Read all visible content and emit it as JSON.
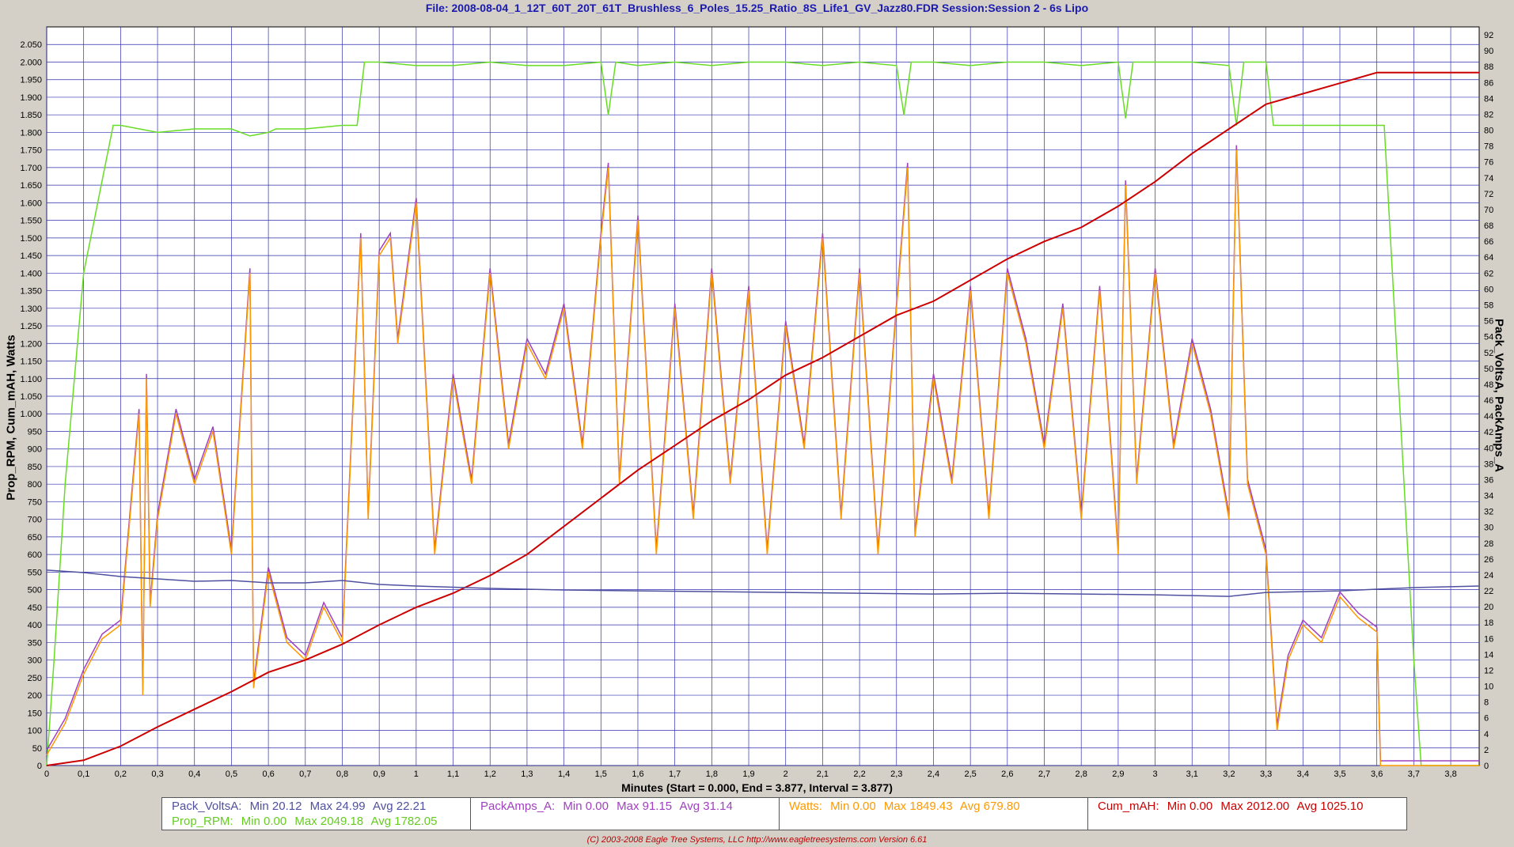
{
  "title": "File: 2008-08-04_1_12T_60T_20T_61T_Brushless_6_Poles_15.25_Ratio_8S_Life1_GV_Jazz80.FDR   Session:Session 2 - 6s Lipo",
  "ylabel_left": "Prop_RPM, Cum_mAH, Watts",
  "ylabel_right": "Pack_VoltsA, PackAmps_A",
  "xlabel": "Minutes (Start = 0.000,  End = 3.877,  Interval =  3.877)",
  "footer": "(C) 2003-2008 Eagle Tree Systems, LLC     http://www.eagletreesystems.com    Version 6.61",
  "colors": {
    "background": "#d4d0c8",
    "plot_bg": "#ffffff",
    "grid": "#2f2fb0",
    "pack_volts": "#5050a0",
    "pack_amps": "#a040c0",
    "watts": "#ff9900",
    "prop_rpm": "#66dd22",
    "cum_mah": "#cc0000"
  },
  "stats": {
    "pack_volts": {
      "name": "Pack_VoltsA:",
      "min": "Min 20.12",
      "max": "Max 24.99",
      "avg": "Avg 22.21"
    },
    "prop_rpm": {
      "name": "Prop_RPM:",
      "min": "Min 0.00",
      "max": "Max 2049.18",
      "avg": "Avg 1782.05"
    },
    "pack_amps": {
      "name": "PackAmps_A:",
      "min": "Min 0.00",
      "max": "Max 91.15",
      "avg": "Avg 31.14"
    },
    "watts": {
      "name": "Watts:",
      "min": "Min 0.00",
      "max": "Max 1849.43",
      "avg": "Avg 679.80"
    },
    "cum_mah": {
      "name": "Cum_mAH:",
      "min": "Min 0.00",
      "max": "Max 2012.00",
      "avg": "Avg 1025.10"
    }
  },
  "chart_data": {
    "type": "line",
    "xlim": [
      0,
      3.877
    ],
    "ylim_left": [
      0,
      2100
    ],
    "ylim_right": [
      0,
      93
    ],
    "grid": true,
    "x_ticks": [
      "0",
      "0,1",
      "0,2",
      "0,3",
      "0,4",
      "0,5",
      "0,6",
      "0,7",
      "0,8",
      "0,9",
      "1",
      "1,1",
      "1,2",
      "1,3",
      "1,4",
      "1,5",
      "1,6",
      "1,7",
      "1,8",
      "1,9",
      "2",
      "2,1",
      "2,2",
      "2,3",
      "2,4",
      "2,5",
      "2,6",
      "2,7",
      "2,8",
      "2,9",
      "3",
      "3,1",
      "3,2",
      "3,3",
      "3,4",
      "3,5",
      "3,6",
      "3,7",
      "3,8"
    ],
    "y_ticks_left": [
      "0",
      "50",
      "100",
      "150",
      "200",
      "250",
      "300",
      "350",
      "400",
      "450",
      "500",
      "550",
      "600",
      "650",
      "700",
      "750",
      "800",
      "850",
      "900",
      "950",
      "1.000",
      "1.050",
      "1.100",
      "1.150",
      "1.200",
      "1.250",
      "1.300",
      "1.350",
      "1.400",
      "1.450",
      "1.500",
      "1.550",
      "1.600",
      "1.650",
      "1.700",
      "1.750",
      "1.800",
      "1.850",
      "1.900",
      "1.950",
      "2.000",
      "2.050"
    ],
    "y_ticks_right": [
      "0",
      "2",
      "4",
      "6",
      "8",
      "10",
      "12",
      "14",
      "16",
      "18",
      "20",
      "22",
      "24",
      "26",
      "28",
      "30",
      "32",
      "34",
      "36",
      "38",
      "40",
      "42",
      "44",
      "46",
      "48",
      "50",
      "52",
      "54",
      "56",
      "58",
      "60",
      "62",
      "64",
      "66",
      "68",
      "70",
      "72",
      "74",
      "76",
      "78",
      "80",
      "82",
      "84",
      "86",
      "88",
      "90",
      "92"
    ],
    "series": [
      {
        "name": "Prop_RPM",
        "axis": "left",
        "x": [
          0,
          0.02,
          0.05,
          0.1,
          0.18,
          0.2,
          0.3,
          0.4,
          0.5,
          0.55,
          0.6,
          0.62,
          0.7,
          0.8,
          0.84,
          0.86,
          0.9,
          1.0,
          1.1,
          1.2,
          1.3,
          1.4,
          1.5,
          1.52,
          1.54,
          1.6,
          1.7,
          1.8,
          1.9,
          2.0,
          2.1,
          2.2,
          2.3,
          2.32,
          2.34,
          2.4,
          2.5,
          2.6,
          2.7,
          2.8,
          2.9,
          2.92,
          2.94,
          3.0,
          3.1,
          3.2,
          3.22,
          3.24,
          3.3,
          3.32,
          3.34,
          3.4,
          3.5,
          3.6,
          3.62,
          3.7,
          3.72,
          3.877
        ],
        "y": [
          0,
          300,
          800,
          1400,
          1820,
          1820,
          1800,
          1810,
          1810,
          1790,
          1800,
          1810,
          1810,
          1820,
          1820,
          2000,
          2000,
          1990,
          1990,
          2000,
          1990,
          1990,
          2000,
          1850,
          2000,
          1990,
          2000,
          1990,
          2000,
          2000,
          1990,
          2000,
          1990,
          1850,
          2000,
          2000,
          1990,
          2000,
          2000,
          1990,
          2000,
          1840,
          2000,
          2000,
          2000,
          1990,
          1820,
          2000,
          2000,
          1820,
          1820,
          1820,
          1820,
          1820,
          1820,
          300,
          0,
          0
        ]
      },
      {
        "name": "Watts",
        "axis": "left",
        "x": [
          0,
          0.05,
          0.1,
          0.15,
          0.2,
          0.25,
          0.26,
          0.27,
          0.28,
          0.3,
          0.35,
          0.4,
          0.45,
          0.5,
          0.55,
          0.56,
          0.6,
          0.65,
          0.7,
          0.75,
          0.8,
          0.85,
          0.87,
          0.9,
          0.93,
          0.95,
          1.0,
          1.05,
          1.1,
          1.15,
          1.2,
          1.25,
          1.3,
          1.35,
          1.4,
          1.45,
          1.5,
          1.52,
          1.55,
          1.6,
          1.65,
          1.7,
          1.75,
          1.8,
          1.85,
          1.9,
          1.95,
          2.0,
          2.05,
          2.1,
          2.15,
          2.2,
          2.25,
          2.3,
          2.33,
          2.35,
          2.4,
          2.45,
          2.5,
          2.55,
          2.6,
          2.65,
          2.7,
          2.75,
          2.8,
          2.85,
          2.9,
          2.92,
          2.95,
          3.0,
          3.05,
          3.1,
          3.15,
          3.2,
          3.22,
          3.25,
          3.3,
          3.33,
          3.36,
          3.4,
          3.45,
          3.5,
          3.55,
          3.6,
          3.61,
          3.877
        ],
        "y": [
          30,
          120,
          260,
          360,
          400,
          1000,
          200,
          1100,
          450,
          700,
          1000,
          800,
          950,
          600,
          1400,
          220,
          550,
          350,
          300,
          450,
          350,
          1500,
          700,
          1450,
          1500,
          1200,
          1600,
          600,
          1100,
          800,
          1400,
          900,
          1200,
          1100,
          1300,
          900,
          1500,
          1700,
          800,
          1550,
          600,
          1300,
          700,
          1400,
          800,
          1350,
          600,
          1250,
          900,
          1500,
          700,
          1400,
          600,
          1300,
          1700,
          650,
          1100,
          800,
          1350,
          700,
          1400,
          1200,
          900,
          1300,
          700,
          1350,
          600,
          1650,
          800,
          1400,
          900,
          1200,
          1000,
          700,
          1750,
          800,
          600,
          100,
          300,
          400,
          350,
          480,
          420,
          380,
          0,
          0
        ]
      },
      {
        "name": "Cum_mAH",
        "axis": "left",
        "x": [
          0,
          0.1,
          0.2,
          0.3,
          0.4,
          0.5,
          0.6,
          0.7,
          0.8,
          0.9,
          1.0,
          1.1,
          1.2,
          1.3,
          1.4,
          1.5,
          1.6,
          1.7,
          1.8,
          1.9,
          2.0,
          2.1,
          2.2,
          2.3,
          2.4,
          2.5,
          2.6,
          2.7,
          2.8,
          2.9,
          3.0,
          3.1,
          3.2,
          3.3,
          3.4,
          3.5,
          3.6,
          3.877
        ],
        "y": [
          0,
          15,
          55,
          110,
          160,
          210,
          265,
          300,
          345,
          400,
          450,
          490,
          540,
          600,
          680,
          760,
          840,
          910,
          980,
          1040,
          1110,
          1160,
          1220,
          1280,
          1320,
          1380,
          1440,
          1490,
          1530,
          1590,
          1660,
          1740,
          1810,
          1880,
          1910,
          1940,
          1970,
          1970
        ]
      },
      {
        "name": "Pack_VoltsA",
        "axis": "right",
        "x": [
          0,
          0.1,
          0.2,
          0.3,
          0.4,
          0.5,
          0.6,
          0.7,
          0.8,
          0.9,
          1.0,
          1.2,
          1.4,
          1.6,
          1.8,
          2.0,
          2.2,
          2.4,
          2.6,
          2.8,
          3.0,
          3.2,
          3.3,
          3.4,
          3.5,
          3.6,
          3.7,
          3.877
        ],
        "y": [
          24.6,
          24.3,
          23.8,
          23.5,
          23.2,
          23.3,
          23.0,
          23.0,
          23.3,
          22.8,
          22.6,
          22.3,
          22.1,
          22.0,
          21.9,
          21.8,
          21.7,
          21.6,
          21.7,
          21.6,
          21.5,
          21.3,
          21.8,
          21.9,
          22.0,
          22.2,
          22.4,
          22.6
        ]
      }
    ]
  }
}
